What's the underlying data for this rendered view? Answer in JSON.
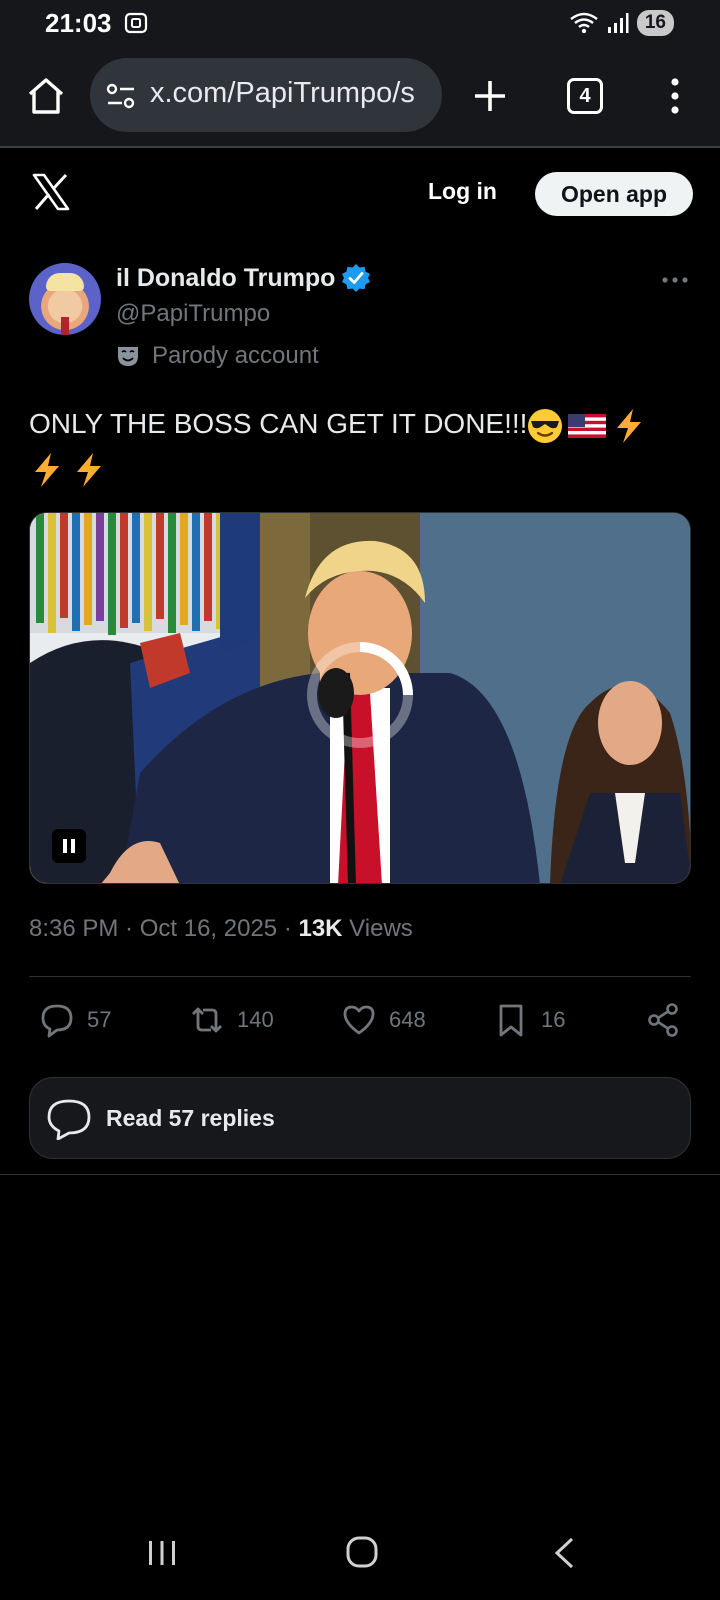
{
  "status_bar": {
    "time": "21:03",
    "battery": "16",
    "icons": [
      "screenshot-icon",
      "wifi-icon",
      "signal-icon"
    ]
  },
  "browser": {
    "url": "x.com/PapiTrumpo/s",
    "tab_count": "4",
    "icons": [
      "home-icon",
      "site-settings-icon",
      "new-tab-icon",
      "menu-icon"
    ]
  },
  "x_header": {
    "login_label": "Log in",
    "open_app_label": "Open app"
  },
  "tweet": {
    "display_name": "il Donaldo Trumpo",
    "handle": "@PapiTrumpo",
    "label": "Parody account",
    "text": "ONLY THE BOSS CAN GET IT DONE!!!",
    "emojis": [
      "sunglasses",
      "us-flag",
      "lightning",
      "lightning",
      "lightning"
    ],
    "meta": {
      "time": "8:36 PM",
      "sep1": " · ",
      "date": "Oct 16, 2025",
      "sep2": " · ",
      "views_count": "13K",
      "views_label": " Views"
    },
    "actions": {
      "replies": "57",
      "reposts": "140",
      "likes": "648",
      "bookmarks": "16"
    },
    "read_replies_label": "Read 57 replies"
  },
  "colors": {
    "background": "#000000",
    "verified": "#1d9bf0",
    "muted_text": "#71767b",
    "text": "#e7e9ea"
  }
}
